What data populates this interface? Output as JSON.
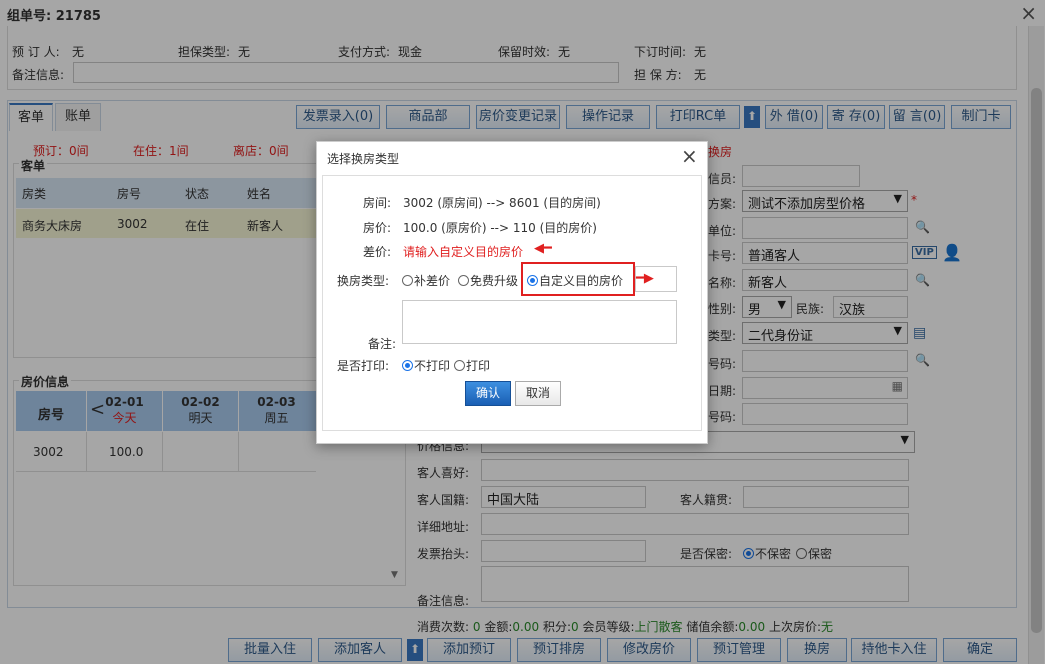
{
  "window": {
    "title": "组单号: 21785"
  },
  "top_info": {
    "reserve_person_label": "预 订 人:",
    "reserve_person": "无",
    "guarantee_type_label": "担保类型:",
    "guarantee_type": "无",
    "payment_label": "支付方式:",
    "payment": "现金",
    "retention_label": "保留时效:",
    "retention": "无",
    "order_time_label": "下订时间:",
    "order_time": "无",
    "remark_label": "备注信息:",
    "guarantor_label": "担 保 方:",
    "guarantor": "无"
  },
  "tabs": [
    {
      "label": "客单"
    },
    {
      "label": "账单"
    }
  ],
  "toolbar": [
    {
      "label": "发票录入(0)"
    },
    {
      "label": "商品部"
    },
    {
      "label": "房价变更记录"
    },
    {
      "label": "操作记录"
    },
    {
      "label": "打印RC单"
    },
    {
      "label": "外 借(0)"
    },
    {
      "label": "寄 存(0)"
    },
    {
      "label": "留 言(0)"
    },
    {
      "label": "制门卡"
    }
  ],
  "status": {
    "reserved": "预订：0间",
    "staying": "在住：1间",
    "left": "离店：0间"
  },
  "guest_section": {
    "title": "客单",
    "columns": [
      "房类",
      "房号",
      "状态",
      "姓名"
    ],
    "rows": [
      {
        "room_type": "商务大床房",
        "room_no": "3002",
        "status": "在住",
        "name": "新客人"
      }
    ]
  },
  "price_section": {
    "title": "房价信息",
    "room_no_header": "房号",
    "dates": [
      {
        "date": "02-01",
        "day": "今天"
      },
      {
        "date": "02-02",
        "day": "明天"
      },
      {
        "date": "02-03",
        "day": "周五"
      }
    ],
    "rows": [
      {
        "room_no": "3002",
        "price": "100.0"
      }
    ]
  },
  "form": {
    "change_room_tag": "换房",
    "sales_label": "信员:",
    "plan_label": "方案:",
    "plan_value": "测试不添加房型价格",
    "plan_required": "*",
    "unit_label": "单位:",
    "card_label": "卡号:",
    "card_value": "普通客人",
    "vip_label": "VIP",
    "name_label": "名称:",
    "name_value": "新客人",
    "gender_label": "性别:",
    "gender_value": "男",
    "nation_label": "民族:",
    "nation_value": "汉族",
    "idtype_label": "类型:",
    "idtype_value": "二代身份证",
    "idno_label": "号码:",
    "birth_label": "日期:",
    "phone_label": "号码:",
    "price_label": "价格信息:",
    "hobby_label": "客人喜好:",
    "country_label": "客人国籍:",
    "country_value": "中国大陆",
    "native_label": "客人籍贯:",
    "address_label": "详细地址:",
    "invoice_label": "发票抬头:",
    "secret_label": "是否保密:",
    "secret_no": "不保密",
    "secret_yes": "保密",
    "remark_label": "备注信息:"
  },
  "consume": {
    "count_label": "消费次数:",
    "count": "0",
    "amount_label": "金额:",
    "amount": "0.00",
    "points_label": "积分:",
    "points": "0",
    "level_label": "会员等级:",
    "level": "上门散客",
    "balance_label": "储值余额:",
    "balance": "0.00",
    "last_price_label": "上次房价:",
    "last_price": "无"
  },
  "bottom_buttons": [
    {
      "label": "批量入住"
    },
    {
      "label": "添加客人"
    },
    {
      "label": "添加预订"
    },
    {
      "label": "预订排房"
    },
    {
      "label": "修改房价"
    },
    {
      "label": "预订管理"
    },
    {
      "label": "换房"
    },
    {
      "label": "持他卡入住"
    },
    {
      "label": "确定"
    }
  ],
  "dialog": {
    "title": "选择换房类型",
    "room_label": "房间:",
    "room_text": "3002 (原房间) --> 8601 (目的房间)",
    "price_label": "房价:",
    "price_text": "100.0 (原房价) --> 110 (目的房价)",
    "diff_label": "差价:",
    "diff_text": "请输入自定义目的房价",
    "type_label": "换房类型:",
    "type_options": [
      "补差价",
      "免费升级",
      "自定义目的房价"
    ],
    "remark_label": "备注:",
    "print_label": "是否打印:",
    "print_options": [
      "不打印",
      "打印"
    ],
    "confirm": "确认",
    "cancel": "取消",
    "close": "×"
  },
  "colors": {
    "accent": "#1a73e8",
    "red": "#e02020",
    "header_blue": "#d8e6f5"
  }
}
